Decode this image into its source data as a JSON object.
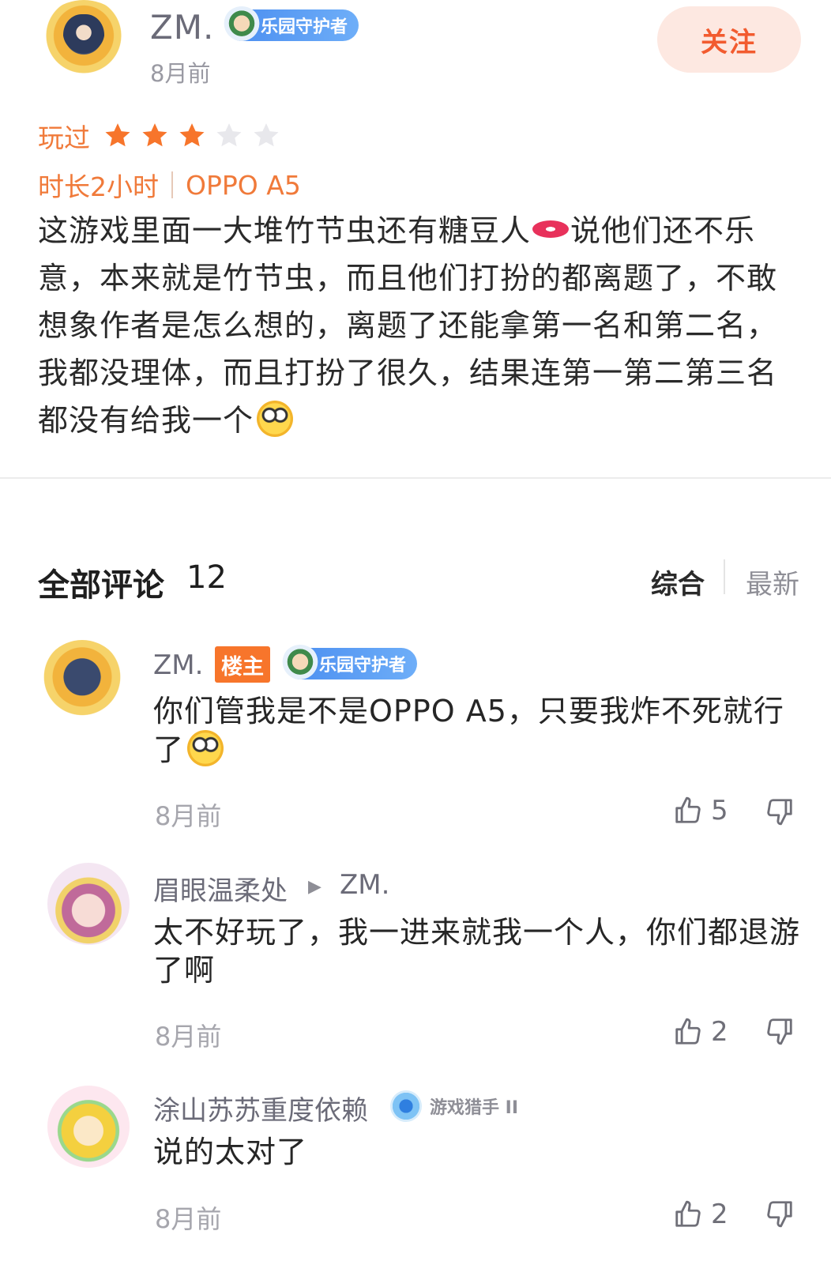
{
  "post": {
    "author": "ZM.",
    "badge": "乐园守护者",
    "time": "8月前",
    "follow_label": "关注",
    "played_label": "玩过",
    "rating": 3,
    "rating_max": 5,
    "duration": "时长2小时",
    "device": "OPPO A5",
    "text_part1": "这游戏里面一大堆竹节虫还有糖豆人",
    "text_part2": "说他们还不乐意，本来就是竹节虫，而且他们打扮的都离题了，不敢想象作者是怎么想的，离题了还能拿第一名和第二名，我都没理体，而且打扮了很久，结果连第一第二第三名都没有给我一个"
  },
  "comments_header": {
    "title": "全部评论",
    "count": "12",
    "sort_combined": "综合",
    "sort_newest": "最新"
  },
  "comments": [
    {
      "name": "ZM.",
      "owner_tag": "楼主",
      "badge": "乐园守护者",
      "text": "你们管我是不是OPPO A5，只要我炸不死就行了",
      "time": "8月前",
      "likes": "5"
    },
    {
      "name": "眉眼温柔处",
      "reply_to": "ZM.",
      "text": "太不好玩了，我一进来就我一个人，你们都退游了啊",
      "time": "8月前",
      "likes": "2"
    },
    {
      "name": "涂山苏苏重度依赖",
      "badge": "游戏猎手 II",
      "text": "说的太对了",
      "time": "8月前",
      "likes": "2"
    }
  ],
  "colors": {
    "accent": "#f07a3a",
    "follow_text": "#f25b2f",
    "follow_bg": "#fde8e1",
    "star_on": "#f7752b",
    "star_off": "#e8e8ec",
    "owner_tag": "#f7752b",
    "badge_blue": "#4a8df0"
  },
  "icons": {
    "like": "thumbs-up-icon",
    "dislike": "thumbs-down-icon",
    "star": "star-icon",
    "reply": "triangle-right-icon"
  }
}
